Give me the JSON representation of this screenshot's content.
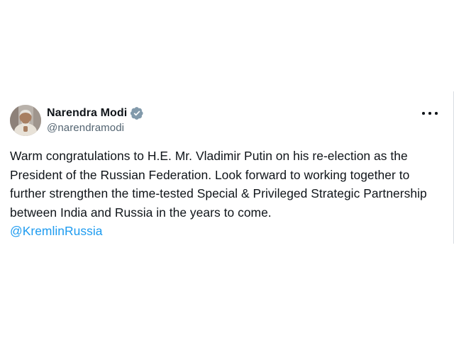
{
  "tweet": {
    "author": {
      "display_name": "Narendra Modi",
      "handle": "@narendramodi",
      "verified": true,
      "avatar_icon": "profile-photo",
      "verified_icon": "verified-badge-icon",
      "verified_color": "#829aab"
    },
    "more_icon": "more-horizontal-icon",
    "text": "Warm congratulations to H.E. Mr. Vladimir Putin on his re-election as the President of the Russian Federation. Look forward to working together to further strengthen the time-tested Special & Privileged Strategic Partnership between India and Russia in the years to come.",
    "mention": "@KremlinRussia"
  },
  "colors": {
    "text_primary": "#0f1419",
    "text_secondary": "#536471",
    "link": "#1d9bf0",
    "background": "#ffffff"
  }
}
